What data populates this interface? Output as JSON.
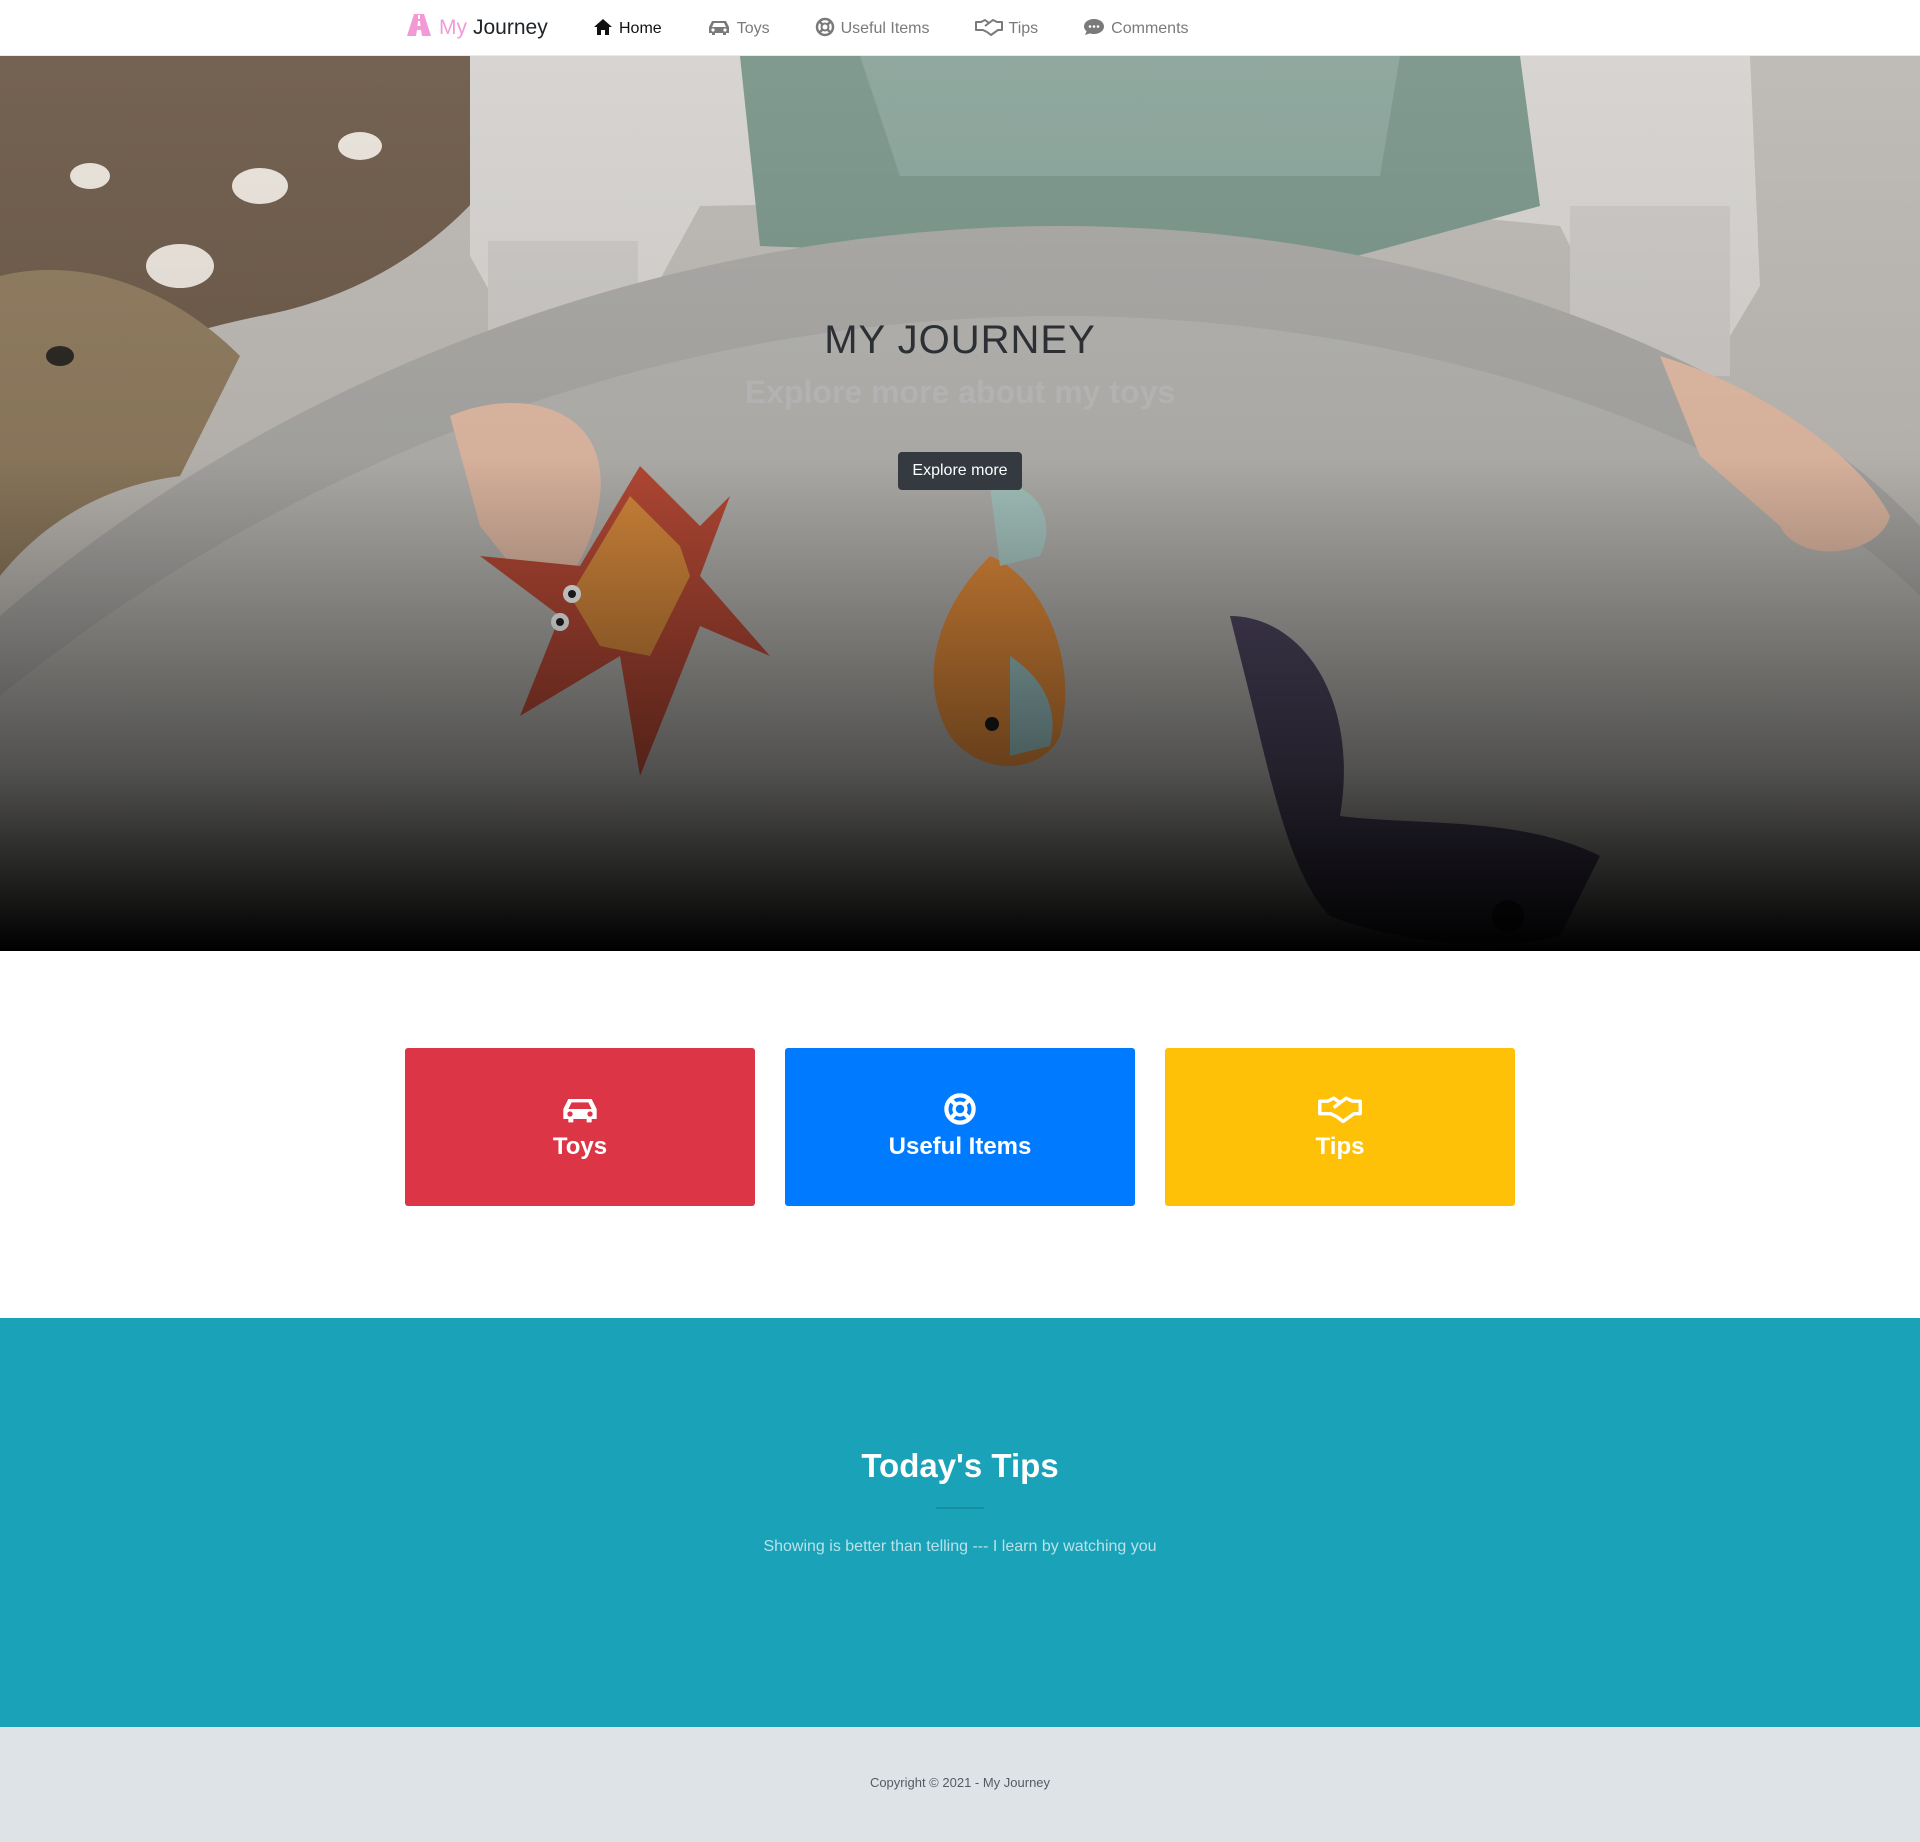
{
  "app": {
    "brand_my": "My",
    "brand_journey": "Journey",
    "brand_icon": "road-icon",
    "brand_color": "#f29ad8"
  },
  "nav": {
    "items": [
      {
        "label": "Home",
        "icon": "home-icon",
        "active": true
      },
      {
        "label": "Toys",
        "icon": "car-icon",
        "active": false
      },
      {
        "label": "Useful Items",
        "icon": "life-ring-icon",
        "active": false
      },
      {
        "label": "Tips",
        "icon": "handshake-icon",
        "active": false
      },
      {
        "label": "Comments",
        "icon": "comment-dots-icon",
        "active": false
      }
    ]
  },
  "hero": {
    "title": "MY JOURNEY",
    "subtitle": "Explore more about my toys",
    "button_label": "Explore more"
  },
  "cards": [
    {
      "label": "Toys",
      "icon": "car-icon",
      "color": "#dc3545"
    },
    {
      "label": "Useful Items",
      "icon": "life-ring-icon",
      "color": "#007bff"
    },
    {
      "label": "Tips",
      "icon": "handshake-icon",
      "color": "#ffc107"
    }
  ],
  "tips": {
    "title": "Today's Tips",
    "text": "Showing is better than telling --- I learn by watching you",
    "background": "#19a2b8"
  },
  "footer": {
    "copyright": "Copyright © 2021 - My Journey"
  }
}
